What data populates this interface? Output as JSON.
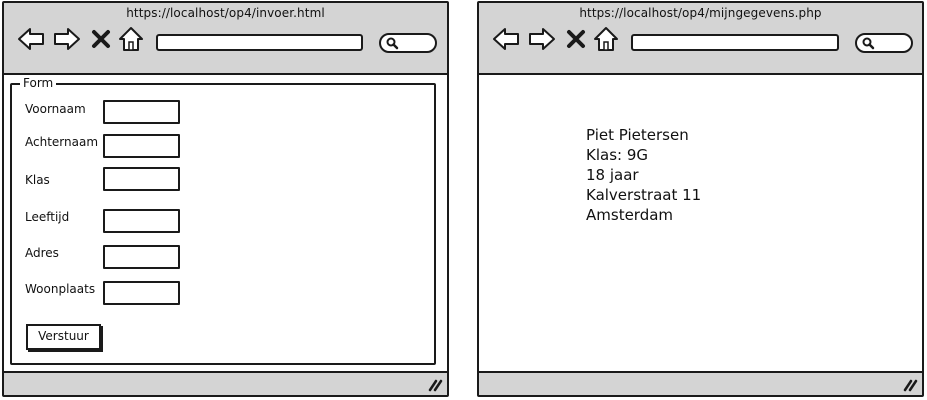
{
  "left_window": {
    "url": "https://localhost/op4/invoer.html",
    "form": {
      "legend": "Form",
      "fields": [
        {
          "label": "Voornaam",
          "value": ""
        },
        {
          "label": "Achternaam",
          "value": ""
        },
        {
          "label": "Klas",
          "value": ""
        },
        {
          "label": "Leeftijd",
          "value": ""
        },
        {
          "label": "Adres",
          "value": ""
        },
        {
          "label": "Woonplaats",
          "value": ""
        }
      ],
      "submit_label": "Verstuur"
    }
  },
  "right_window": {
    "url": "https://localhost/op4/mijngegevens.php",
    "lines": [
      "Piet Pietersen",
      "Klas: 9G",
      "18 jaar",
      "Kalverstraat 11",
      "Amsterdam"
    ]
  },
  "icons": {
    "back": "arrow-left-icon",
    "forward": "arrow-right-icon",
    "stop": "close-icon",
    "home": "home-icon",
    "search": "search-icon",
    "resize": "resize-grip-icon"
  },
  "colors": {
    "chrome": "#d4d4d4",
    "stroke": "#1a1a1a",
    "background": "#ffffff"
  }
}
